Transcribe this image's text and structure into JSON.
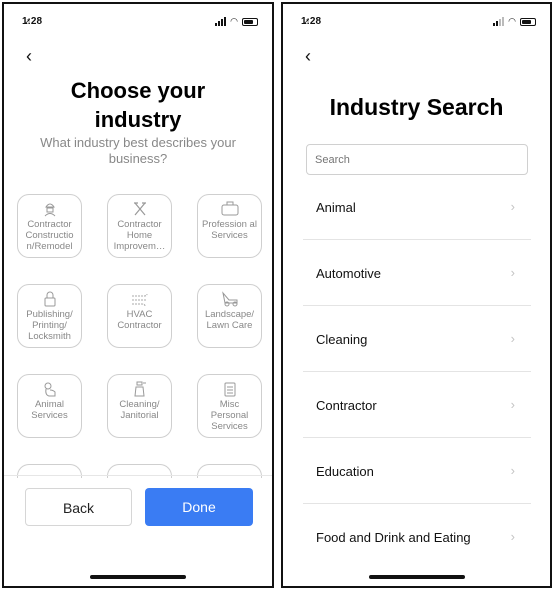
{
  "left": {
    "status_time": "1:28",
    "back_glyph": "‹",
    "title": "Choose your industry",
    "subtitle": "What industry best describes your business?",
    "tiles": [
      {
        "label": "Contractor Constructio n/Remodel",
        "icon": "worker-icon"
      },
      {
        "label": "Contractor Home Improvem…",
        "icon": "tools-icon"
      },
      {
        "label": "Profession al Services",
        "icon": "briefcase-icon"
      },
      {
        "label": "Publishing/ Printing/ Locksmith",
        "icon": "lock-icon"
      },
      {
        "label": "HVAC Contractor",
        "icon": "airflow-icon"
      },
      {
        "label": "Landscape/ Lawn Care",
        "icon": "lawnmower-icon"
      },
      {
        "label": "Animal Services",
        "icon": "dog-icon"
      },
      {
        "label": "Cleaning/ Janitorial",
        "icon": "spray-bottle-icon"
      },
      {
        "label": "Misc Personal Services",
        "icon": "clipboard-icon"
      }
    ],
    "back_button": "Back",
    "done_button": "Done",
    "accent": "#3a7cf3"
  },
  "right": {
    "status_time": "1:28",
    "back_glyph": "‹",
    "title": "Industry Search",
    "search_placeholder": "Search",
    "items": [
      "Animal",
      "Automotive",
      "Cleaning",
      "Contractor",
      "Education",
      "Food and Drink and Eating"
    ]
  }
}
